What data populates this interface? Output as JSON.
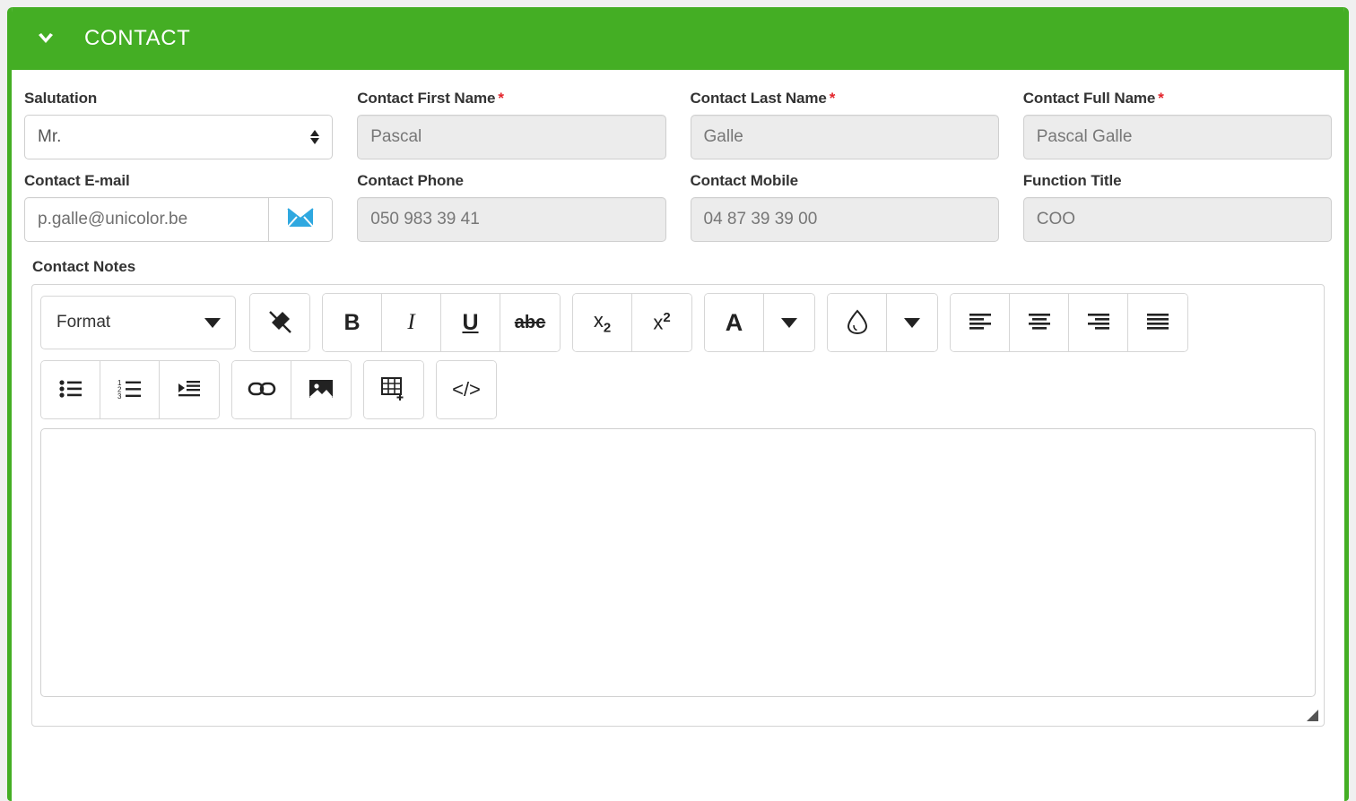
{
  "header": {
    "title": "CONTACT",
    "collapse_icon": "chevron-down-icon",
    "background_color": "#44ae24"
  },
  "form": {
    "fields": [
      {
        "label": "Salutation",
        "required": false,
        "type": "select",
        "value": "Mr."
      },
      {
        "label": "Contact First Name",
        "required": true,
        "type": "text",
        "value": "Pascal"
      },
      {
        "label": "Contact Last Name",
        "required": true,
        "type": "text",
        "value": "Galle"
      },
      {
        "label": "Contact Full Name",
        "required": true,
        "type": "text",
        "value": "Pascal Galle"
      },
      {
        "label": "Contact E-mail",
        "required": false,
        "type": "text-with-button",
        "value": "p.galle@unicolor.be",
        "button_icon": "envelope-icon"
      },
      {
        "label": "Contact Phone",
        "required": false,
        "type": "text",
        "value": "050 983 39 41"
      },
      {
        "label": "Contact Mobile",
        "required": false,
        "type": "text",
        "value": "04 87 39 39 00"
      },
      {
        "label": "Function Title",
        "required": false,
        "type": "text",
        "value": "COO"
      }
    ],
    "required_marker": "*"
  },
  "notes": {
    "label": "Contact Notes",
    "editor": {
      "format_select": {
        "value": "Format",
        "icon": "chevron-down-icon"
      },
      "toolbar_row_1": [
        {
          "name": "remove-format-button",
          "icon": "remove-format-icon",
          "label": ""
        },
        {
          "name": "bold-button",
          "icon": "bold-icon",
          "label": "B"
        },
        {
          "name": "italic-button",
          "icon": "italic-icon",
          "label": "I"
        },
        {
          "name": "underline-button",
          "icon": "underline-icon",
          "label": "U"
        },
        {
          "name": "strikethrough-button",
          "icon": "strikethrough-icon",
          "label": "abc"
        },
        {
          "name": "subscript-button",
          "icon": "subscript-icon",
          "label": "x2"
        },
        {
          "name": "superscript-button",
          "icon": "superscript-icon",
          "label": "x2"
        },
        {
          "name": "text-color-button",
          "icon": "text-color-icon",
          "label": "A"
        },
        {
          "name": "text-color-dropdown",
          "icon": "chevron-down-icon",
          "label": ""
        },
        {
          "name": "background-color-button",
          "icon": "droplet-icon",
          "label": ""
        },
        {
          "name": "background-color-dropdown",
          "icon": "chevron-down-icon",
          "label": ""
        },
        {
          "name": "align-left-button",
          "icon": "align-left-icon",
          "label": ""
        },
        {
          "name": "align-center-button",
          "icon": "align-center-icon",
          "label": ""
        },
        {
          "name": "align-right-button",
          "icon": "align-right-icon",
          "label": ""
        },
        {
          "name": "align-justify-button",
          "icon": "align-justify-icon",
          "label": ""
        }
      ],
      "toolbar_row_2": [
        {
          "name": "bulleted-list-button",
          "icon": "bulleted-list-icon",
          "label": ""
        },
        {
          "name": "numbered-list-button",
          "icon": "numbered-list-icon",
          "label": ""
        },
        {
          "name": "increase-indent-button",
          "icon": "increase-indent-icon",
          "label": ""
        },
        {
          "name": "insert-link-button",
          "icon": "link-icon",
          "label": ""
        },
        {
          "name": "insert-image-button",
          "icon": "image-icon",
          "label": ""
        },
        {
          "name": "insert-table-button",
          "icon": "table-icon",
          "label": ""
        },
        {
          "name": "source-code-button",
          "icon": "code-icon",
          "label": "</>"
        }
      ],
      "content": "",
      "resize_handle_icon": "resize-handle-icon"
    }
  }
}
